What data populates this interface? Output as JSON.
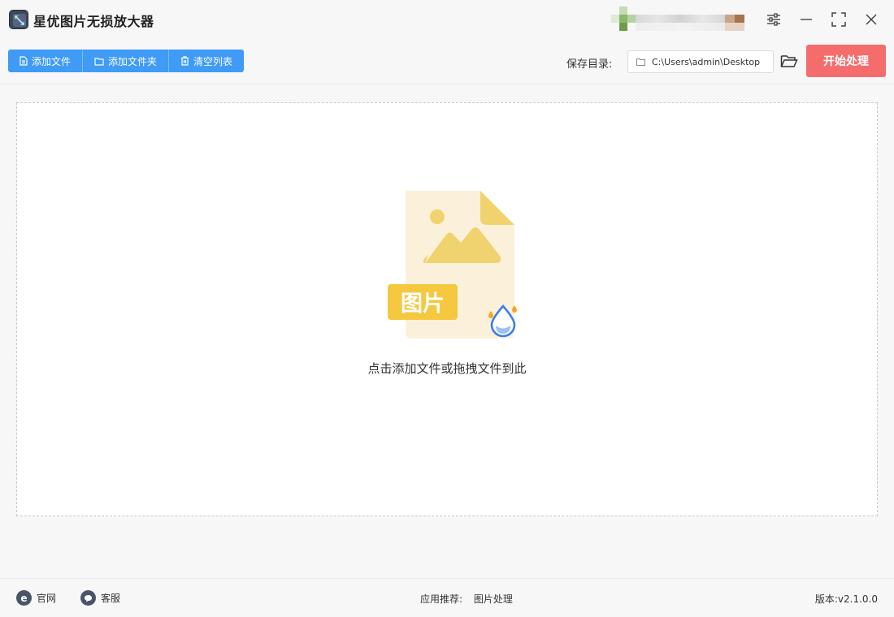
{
  "app": {
    "title": "星优图片无损放大器"
  },
  "window_controls": {
    "settings_icon": "sliders-icon",
    "minimize_icon": "minimize-icon",
    "maximize_icon": "maximize-icon",
    "close_icon": "close-icon"
  },
  "toolbar": {
    "add_file_label": "添加文件",
    "add_folder_label": "添加文件夹",
    "clear_list_label": "清空列表",
    "save_dir_label": "保存目录:",
    "save_path": "C:\\Users\\admin\\Desktop",
    "start_label": "开始处理"
  },
  "dropzone": {
    "badge_text": "图片",
    "hint": "点击添加文件或拖拽文件到此"
  },
  "footer": {
    "website_label": "官网",
    "support_label": "客服",
    "recommend_label": "应用推荐:",
    "recommend_link": "图片处理",
    "version": "版本:v2.1.0.0"
  },
  "colors": {
    "primary": "#3f9bf5",
    "start": "#f56c6c",
    "illustration_yellow": "#f0d36e",
    "illustration_bg": "#fbf1db",
    "badge": "#f5c840",
    "drop_blue": "#3a7fe8"
  }
}
